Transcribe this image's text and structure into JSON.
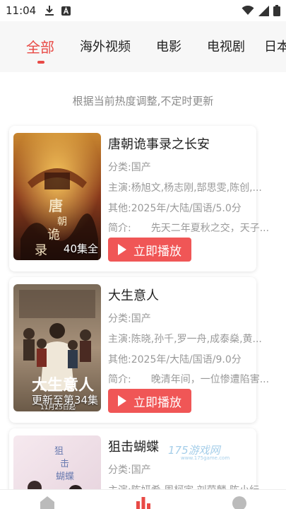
{
  "status_bar": {
    "time": "11:04",
    "icons_left": [
      "download-icon",
      "a-badge-icon"
    ],
    "icons_right": [
      "wifi-icon",
      "signal-icon",
      "battery-icon"
    ]
  },
  "tabs": [
    {
      "label": "全部",
      "active": true
    },
    {
      "label": "海外视频",
      "active": false
    },
    {
      "label": "电影",
      "active": false
    },
    {
      "label": "电视剧",
      "active": false
    },
    {
      "label": "日本",
      "active": false
    }
  ],
  "notice": "根据当前热度调整,不定时更新",
  "items": [
    {
      "title": "唐朝诡事录之长安",
      "category": "分类:国产",
      "cast": "主演:杨旭文,杨志刚,郜思雯,陈创,...",
      "other": "其他:2025年/大陆/国语/5.0分",
      "synopsis": "简介:　　先天二年夏秋之交，天子...",
      "badge": "40集全",
      "badge_sub": "",
      "play_label": "立即播放"
    },
    {
      "title": "大生意人",
      "category": "分类:国产",
      "cast": "主演:陈晓,孙千,罗一舟,成泰燊,黄...",
      "other": "其他:2025年/大陆/国语/9.0分",
      "synopsis": "简介:　　晚清年间，一位惨遭陷害...",
      "badge": "更新至第34集",
      "badge_sub": "11月25日起",
      "play_label": "立即播放"
    },
    {
      "title": "狙击蝴蝶",
      "category": "分类:国产",
      "cast": "主演:陈妍希,周柯宇,刘茵麟,陈小纭,..."
    }
  ],
  "watermark": {
    "text": "175游戏网",
    "sub": "www.175game.com"
  },
  "colors": {
    "accent": "#e84a46",
    "play_button": "#f05656",
    "muted": "#999999"
  }
}
